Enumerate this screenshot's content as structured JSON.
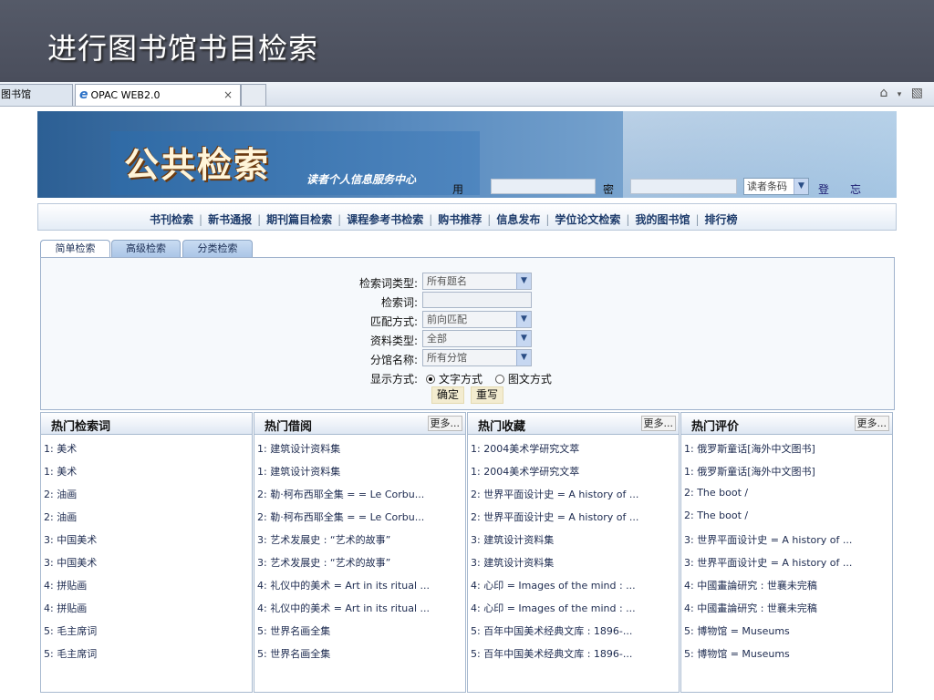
{
  "slide": {
    "title": "进行图书馆书目检索"
  },
  "browser": {
    "tabs": [
      {
        "label": "图书馆"
      },
      {
        "label": "OPAC WEB2.0",
        "close": "×"
      },
      {
        "label": ""
      }
    ],
    "toolbar_icons": [
      "home-icon",
      "feed-icon"
    ]
  },
  "banner": {
    "title": "公共检索",
    "subtitle": "读者个人信息服务中心",
    "login": {
      "username_label": "用户名",
      "password_label": "密码",
      "type_select": "读者条码",
      "login_label": "登录",
      "forgot_label": "忘记密码"
    }
  },
  "nav": {
    "items": [
      "书刊检索",
      "新书通报",
      "期刊篇目检索",
      "课程参考书检索",
      "购书推荐",
      "信息发布",
      "学位论文检索",
      "我的图书馆",
      "排行榜"
    ]
  },
  "search": {
    "tabs": [
      "简单检索",
      "高级检索",
      "分类检索"
    ],
    "fields": {
      "term_type": {
        "label": "检索词类型:",
        "value": "所有题名"
      },
      "term": {
        "label": "检索词:",
        "value": ""
      },
      "match": {
        "label": "匹配方式:",
        "value": "前向匹配"
      },
      "doc_type": {
        "label": "资料类型:",
        "value": "全部"
      },
      "branch": {
        "label": "分馆名称:",
        "value": "所有分馆"
      },
      "display": {
        "label": "显示方式:",
        "options": [
          "文字方式",
          "图文方式"
        ],
        "selected": 0
      }
    },
    "submit_label": "确定",
    "reset_label": "重写"
  },
  "hot": [
    {
      "title": "热门检索词",
      "more": "",
      "items": [
        "1: 美术",
        "1: 美术",
        "2: 油画",
        "2: 油画",
        "3: 中国美术",
        "3: 中国美术",
        "4: 拼贴画",
        "4: 拼贴画",
        "5: 毛主席词",
        "5: 毛主席词"
      ]
    },
    {
      "title": "热门借阅",
      "more": "更多...",
      "items": [
        "1: 建筑设计资料集",
        "1: 建筑设计资料集",
        "2: 勒·柯布西耶全集 = = Le Corbu...",
        "2: 勒·柯布西耶全集 = = Le Corbu...",
        "3: 艺术发展史 : “艺术的故事”",
        "3: 艺术发展史 : “艺术的故事”",
        "4: 礼仪中的美术 = Art in its ritual ...",
        "4: 礼仪中的美术 = Art in its ritual ...",
        "5: 世界名画全集",
        "5: 世界名画全集"
      ]
    },
    {
      "title": "热门收藏",
      "more": "更多...",
      "items": [
        "1: 2004美术学研究文萃",
        "1: 2004美术学研究文萃",
        "2: 世界平面设计史 = A history of ...",
        "2: 世界平面设计史 = A history of ...",
        "3: 建筑设计资料集",
        "3: 建筑设计资料集",
        "4: 心印 = Images of the mind : ...",
        "4: 心印 = Images of the mind : ...",
        "5: 百年中国美术经典文库 : 1896-...",
        "5: 百年中国美术经典文库 : 1896-..."
      ]
    },
    {
      "title": "热门评价",
      "more": "更多...",
      "items": [
        "1: 俄罗斯童话[海外中文图书]",
        "1: 俄罗斯童话[海外中文图书]",
        "2: The boot /",
        "2: The boot /",
        "3: 世界平面设计史 = A history of ...",
        "3: 世界平面设计史 = A history of ...",
        "4: 中國畫論研究 : 世襄未完稿",
        "4: 中國畫論研究 : 世襄未完稿",
        "5: 博物馆 = Museums",
        "5: 博物馆 = Museums"
      ]
    }
  ]
}
